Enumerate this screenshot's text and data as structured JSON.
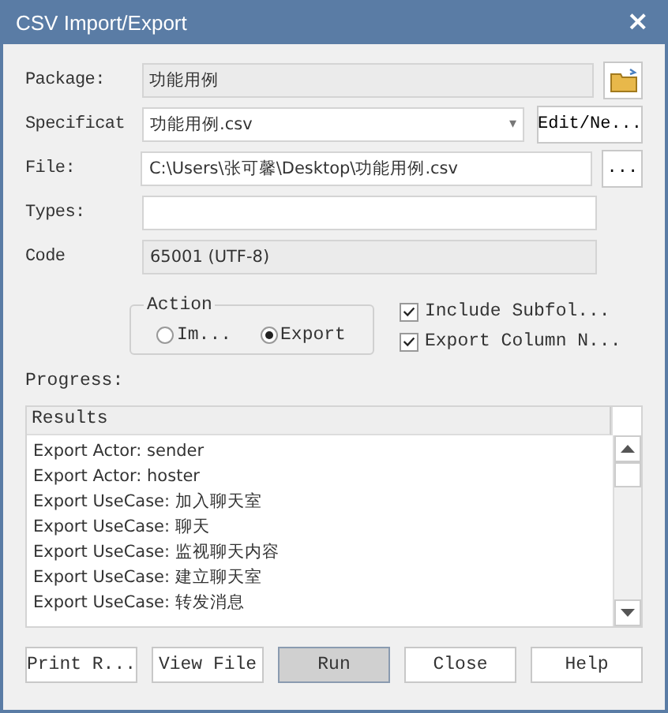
{
  "window": {
    "title": "CSV Import/Export",
    "close": "×"
  },
  "fields": [
    {
      "kind": "readonly",
      "label": "Package:",
      "value": "功能用例",
      "button": {
        "kind": "icon"
      }
    },
    {
      "kind": "dropdown",
      "label": "Specificat",
      "value": "功能用例.csv",
      "caret": "▾",
      "button": {
        "kind": "text",
        "label": "Edit/Ne..."
      }
    },
    {
      "kind": "text",
      "label": "File:",
      "value": "C:\\Users\\张可馨\\Desktop\\功能用例.csv",
      "button": {
        "kind": "text",
        "label": "..."
      }
    },
    {
      "kind": "text",
      "label": "Types:"
    },
    {
      "kind": "readonly",
      "label": "Code",
      "value": "65001 (UTF-8)"
    }
  ],
  "action": {
    "title": "Action",
    "options": [
      {
        "label": "Im...",
        "selected": false
      },
      {
        "label": "Export",
        "selected": true
      }
    ]
  },
  "checkboxes": [
    {
      "label": "Include Subfol...",
      "checked": true
    },
    {
      "label": "Export Column N...",
      "checked": true
    }
  ],
  "progress_label": "Progress:",
  "results": {
    "header": "Results",
    "rows": [
      "Export Actor: sender",
      "Export Actor: hoster",
      "Export UseCase: 加入聊天室",
      "Export UseCase: 聊天",
      "Export UseCase: 监视聊天内容",
      "Export UseCase: 建立聊天室",
      "Export UseCase: 转发消息"
    ]
  },
  "buttons": [
    {
      "label": "Print R...",
      "selected": false
    },
    {
      "label": "View File",
      "selected": false
    },
    {
      "label": "Run",
      "selected": true
    },
    {
      "label": "Close",
      "selected": false
    },
    {
      "label": "Help",
      "selected": false
    }
  ]
}
